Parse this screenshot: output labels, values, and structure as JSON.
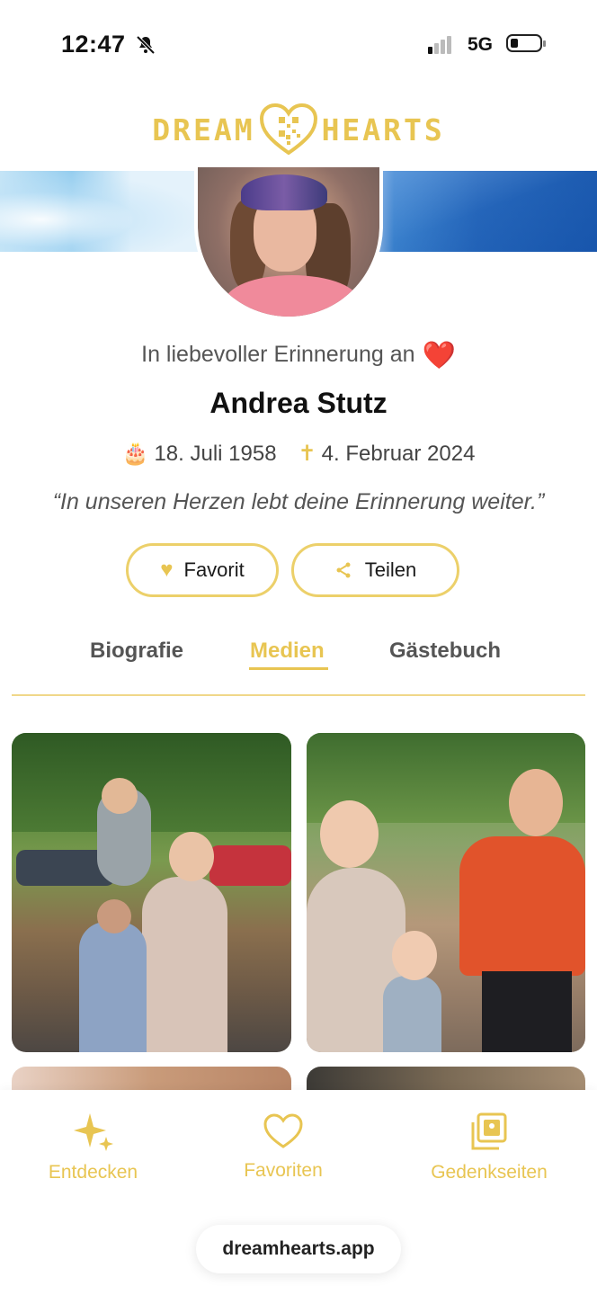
{
  "status_bar": {
    "time": "12:47",
    "network": "5G"
  },
  "logo": {
    "left_text": "DREAM",
    "right_text": "HEARTS"
  },
  "profile": {
    "memory_text": "In liebevoller Erinnerung an",
    "memory_emoji": "❤️",
    "name": "Andrea Stutz",
    "birth_date": "18. Juli 1958",
    "death_date": "4. Februar 2024",
    "quote": "“In unseren Herzen lebt deine Erinnerung weiter.”"
  },
  "actions": {
    "favorite_label": "Favorit",
    "share_label": "Teilen"
  },
  "tabs": [
    {
      "label": "Biografie"
    },
    {
      "label": "Medien"
    },
    {
      "label": "Gästebuch"
    }
  ],
  "active_tab": "Medien",
  "bottom_nav": [
    {
      "label": "Entdecken",
      "icon": "sparkles-icon"
    },
    {
      "label": "Favoriten",
      "icon": "heart-outline-icon"
    },
    {
      "label": "Gedenkseiten",
      "icon": "photo-stack-icon"
    }
  ],
  "browser": {
    "url": "dreamhearts.app"
  },
  "colors": {
    "accent": "#e8c552",
    "heart": "#d41f2b"
  }
}
